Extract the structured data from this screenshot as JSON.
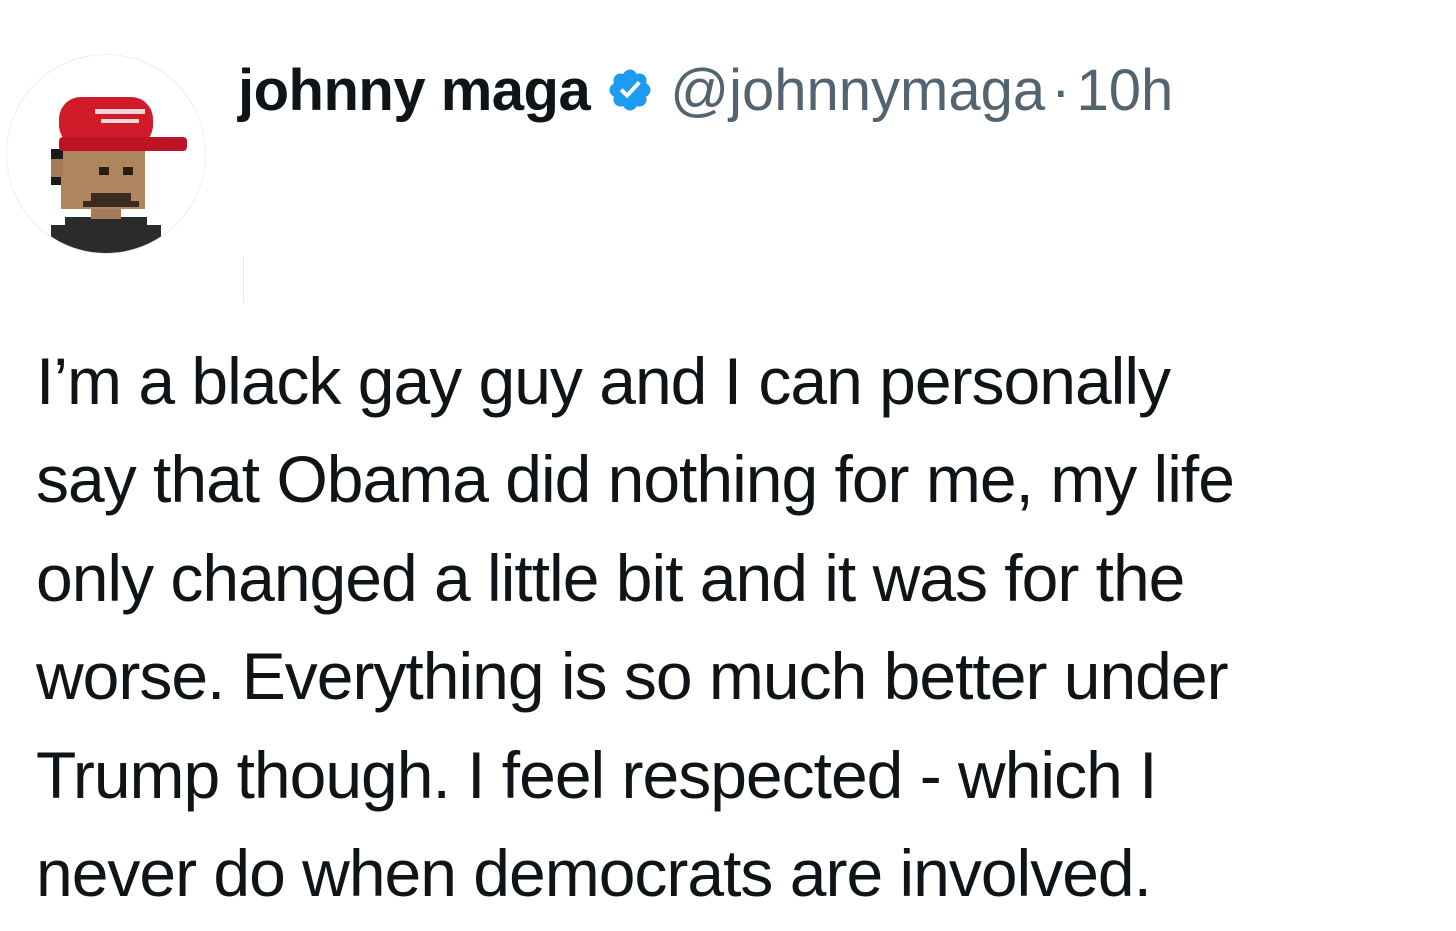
{
  "author": {
    "display_name": "johnny maga",
    "handle": "@johnnymaga",
    "separator": "·",
    "time": "10h",
    "verified": true,
    "verified_icon": "verified-badge-icon",
    "verified_color": "#1d9bf0",
    "avatar_icon": "pixel-avatar-red-cap"
  },
  "tweet": {
    "lines": [
      "I’m a black gay guy and I can personally",
      "say that Obama did nothing for me, my life",
      "only changed a little bit and it was for the",
      "worse. Everything is so much better under",
      "Trump though. I feel respected - which I",
      "never do when democrats are involved."
    ]
  },
  "colors": {
    "text": "#0f1419",
    "secondary_text": "#536471",
    "background": "#ffffff"
  }
}
